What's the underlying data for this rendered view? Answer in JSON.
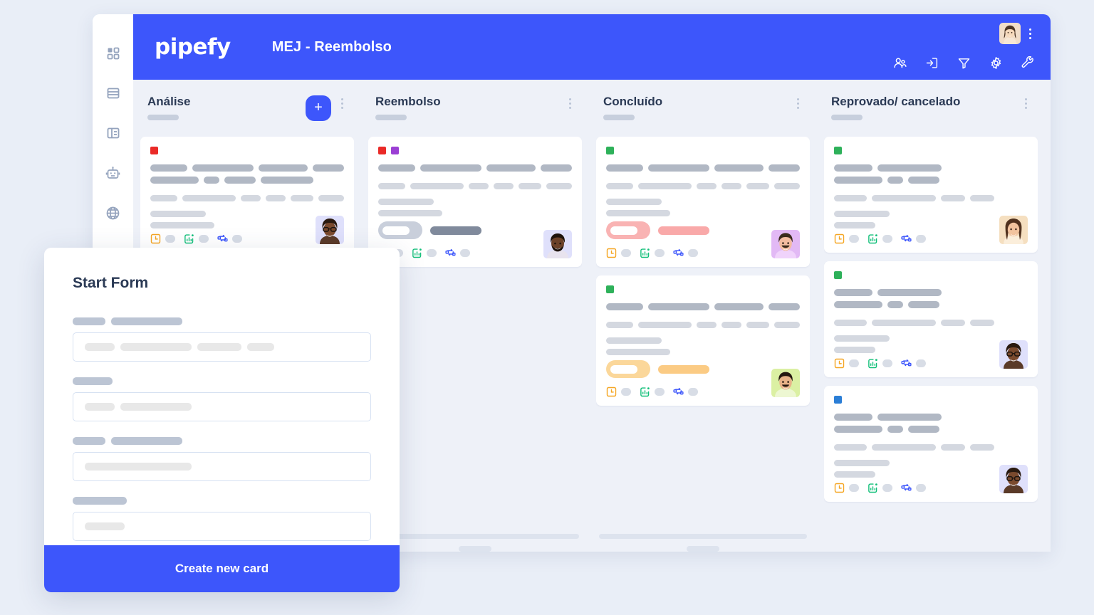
{
  "colors": {
    "brand_blue": "#3d56fb",
    "page_bg": "#e9eef7",
    "board_bg": "#eef1f8",
    "card_white": "#ffffff",
    "title_ink": "#2b3a55",
    "skeleton_grey": "#c7cfdd",
    "label_red": "#ea2a27",
    "label_purple": "#9b3fd4",
    "label_green": "#2eb15a",
    "label_blue": "#2b7ed6",
    "toggle_pink": "#f9b3b3",
    "toggle_orange": "#fbd79a",
    "toggle_grey": "#c9cfdb",
    "icon_orange": "#f5a623",
    "icon_green": "#13c07a",
    "icon_blue": "#3d56fb"
  },
  "sidebar": {
    "items": [
      {
        "name": "apps-grid-icon",
        "label": "Apps"
      },
      {
        "name": "database-icon",
        "label": "Database"
      },
      {
        "name": "layout-panel-icon",
        "label": "Layout"
      },
      {
        "name": "robot-icon",
        "label": "Automations"
      },
      {
        "name": "globe-icon",
        "label": "Public"
      }
    ]
  },
  "header": {
    "logo_text": "pipefy",
    "board_title": "MEJ - Reembolso",
    "tools": [
      {
        "name": "members-icon",
        "label": "Members"
      },
      {
        "name": "inbox-archive-icon",
        "label": "Inbox"
      },
      {
        "name": "filter-icon",
        "label": "Filter"
      },
      {
        "name": "settings-gear-icon",
        "label": "Settings"
      },
      {
        "name": "wrench-tools-icon",
        "label": "Tools"
      }
    ],
    "avatar_alt": "User avatar",
    "kebab_label": "More options"
  },
  "board": {
    "columns": [
      {
        "title": "Análise",
        "has_add_button": true,
        "add_label": "+",
        "menu_label": "Phase options",
        "cards": [
          {
            "labels": [
              "#ea2a27"
            ],
            "title_bars": [
              [
                54,
                90,
                72,
                46
              ],
              [
                68,
                22,
                44,
                74
              ]
            ],
            "meta_bars": [
              [
                46,
                90,
                34,
                34,
                38,
                44
              ],
              [
                78
              ],
              [
                90
              ]
            ],
            "toggle": null,
            "avatar": "avatar-glasses-woman"
          }
        ],
        "footer": {
          "bar": true,
          "pill": false
        }
      },
      {
        "title": "Reembolso",
        "has_add_button": false,
        "menu_label": "Phase options",
        "cards": [
          {
            "labels": [
              "#ea2a27",
              "#9b3fd4"
            ],
            "title_bars": [
              [
                54,
                90,
                72,
                46
              ]
            ],
            "meta_bars": [
              [
                46,
                90,
                34,
                34,
                38,
                44
              ],
              [
                78
              ],
              [
                90
              ]
            ],
            "toggle": {
              "bg": "#c9cfdb",
              "tail": "#808a9c",
              "tail_w": 72
            },
            "avatar": "avatar-beard-man"
          }
        ],
        "footer": {
          "bar": true,
          "pill": true
        }
      },
      {
        "title": "Concluído",
        "has_add_button": false,
        "menu_label": "Phase options",
        "cards": [
          {
            "labels": [
              "#2eb15a"
            ],
            "title_bars": [
              [
                54,
                90,
                72,
                46
              ]
            ],
            "meta_bars": [
              [
                46,
                90,
                34,
                34,
                38,
                44
              ],
              [
                78
              ],
              [
                90
              ]
            ],
            "toggle": {
              "bg": "#f9b3b3",
              "tail": "#f9a9a9",
              "tail_w": 72
            },
            "avatar": "avatar-smiling-man"
          },
          {
            "labels": [
              "#2eb15a"
            ],
            "title_bars": [
              [
                54,
                90,
                72,
                46
              ]
            ],
            "meta_bars": [
              [
                46,
                90,
                34,
                34,
                38,
                44
              ],
              [
                78
              ],
              [
                90
              ]
            ],
            "toggle": {
              "bg": "#fbd79a",
              "tail": "#fbcb84",
              "tail_w": 72
            },
            "avatar": "avatar-short-hair-man"
          }
        ],
        "footer": {
          "bar": true,
          "pill": true
        }
      },
      {
        "title": "Reprovado/ cancelado",
        "has_add_button": false,
        "menu_label": "Phase options",
        "cards": [
          {
            "labels": [
              "#2eb15a"
            ],
            "title_bars": [
              [
                54,
                90
              ],
              [
                68,
                22,
                44
              ]
            ],
            "meta_bars": [
              [
                46,
                90,
                34,
                34
              ],
              [
                78
              ],
              [
                58
              ]
            ],
            "toggle": null,
            "avatar": "avatar-long-hair-woman"
          },
          {
            "labels": [
              "#2eb15a"
            ],
            "title_bars": [
              [
                54,
                90
              ],
              [
                68,
                22,
                44
              ]
            ],
            "meta_bars": [
              [
                46,
                90,
                34,
                34
              ],
              [
                78
              ],
              [
                58
              ]
            ],
            "toggle": null,
            "avatar": "avatar-glasses-woman"
          },
          {
            "labels": [
              "#2b7ed6"
            ],
            "title_bars": [
              [
                54,
                90
              ],
              [
                68,
                22,
                44
              ]
            ],
            "meta_bars": [
              [
                46,
                90,
                34,
                34
              ],
              [
                78
              ],
              [
                58
              ]
            ],
            "toggle": null,
            "avatar": "avatar-glasses-woman"
          }
        ],
        "footer": {
          "bar": false,
          "pill": false
        }
      }
    ],
    "card_footer_icons": [
      {
        "name": "due-date-icon",
        "color": "#f5a623"
      },
      {
        "name": "checklist-progress-icon",
        "color": "#13c07a"
      },
      {
        "name": "connected-cards-icon",
        "color": "#3d56fb"
      }
    ]
  },
  "modal": {
    "title": "Start Form",
    "submit_label": "Create new card",
    "fields": [
      {
        "label_bars": [
          46,
          100
        ],
        "input_bars": [
          42,
          100,
          62,
          38
        ]
      },
      {
        "label_bars": [
          56
        ],
        "input_bars": [
          42,
          100
        ]
      },
      {
        "label_bars": [
          46,
          100
        ],
        "input_bars": [
          150
        ]
      },
      {
        "label_bars": [
          76
        ],
        "input_bars": [
          56
        ]
      }
    ]
  }
}
